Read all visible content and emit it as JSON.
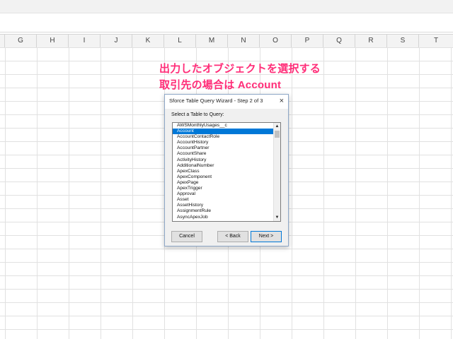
{
  "spreadsheet": {
    "columns": [
      {
        "label": "G"
      },
      {
        "label": "H"
      },
      {
        "label": "I"
      },
      {
        "label": "J"
      },
      {
        "label": "K"
      },
      {
        "label": "L"
      },
      {
        "label": "M"
      },
      {
        "label": "N"
      },
      {
        "label": "O"
      },
      {
        "label": "P"
      },
      {
        "label": "Q"
      },
      {
        "label": "R"
      },
      {
        "label": "S"
      },
      {
        "label": "T"
      }
    ]
  },
  "annotation": {
    "line1": "出力したオブジェクトを選択する",
    "line2": "取引先の場合は Account",
    "color": "#ff2d78"
  },
  "dialog": {
    "title": "Sforce Table Query Wizard - Step 2 of 3",
    "close_icon": "×",
    "prompt": "Select a Table to Query:",
    "items": [
      {
        "label": "AWSMonthlyUsages__c"
      },
      {
        "label": "Account"
      },
      {
        "label": "AccountContactRole"
      },
      {
        "label": "AccountHistory"
      },
      {
        "label": "AccountPartner"
      },
      {
        "label": "AccountShare"
      },
      {
        "label": "ActivityHistory"
      },
      {
        "label": "AdditionalNumber"
      },
      {
        "label": "ApexClass"
      },
      {
        "label": "ApexComponent"
      },
      {
        "label": "ApexPage"
      },
      {
        "label": "ApexTrigger"
      },
      {
        "label": "Approval"
      },
      {
        "label": "Asset"
      },
      {
        "label": "AssetHistory"
      },
      {
        "label": "AssignmentRule"
      },
      {
        "label": "AsyncApexJob"
      }
    ],
    "selected": "Account",
    "scroll_up_icon": "▲",
    "scroll_down_icon": "▼",
    "buttons": {
      "cancel": "Cancel",
      "back": "< Back",
      "next": "Next >"
    }
  }
}
